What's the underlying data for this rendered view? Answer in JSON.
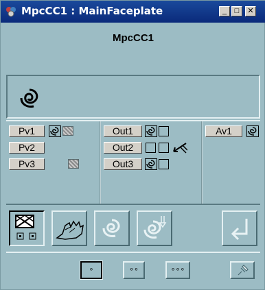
{
  "window": {
    "title": "MpcCC1 : MainFaceplate",
    "min_label": "_",
    "max_label": "□",
    "close_label": "✕"
  },
  "header": {
    "name": "MpcCC1"
  },
  "status_panel": {
    "icon": "mpc-swirl-icon"
  },
  "inputs": [
    {
      "label": "Pv1"
    },
    {
      "label": "Pv2"
    },
    {
      "label": "Pv3"
    }
  ],
  "outputs": [
    {
      "label": "Out1"
    },
    {
      "label": "Out2"
    },
    {
      "label": "Out3"
    }
  ],
  "auxiliary": [
    {
      "label": "Av1"
    }
  ],
  "mode_buttons": [
    {
      "name": "disabled-mode",
      "icon": "crossed-envelope-icon"
    },
    {
      "name": "manual-mode",
      "icon": "hand-icon"
    },
    {
      "name": "auto-mode",
      "icon": "swirl-icon"
    },
    {
      "name": "cascade-mode",
      "icon": "swirl-plug-icon"
    },
    {
      "name": "enter",
      "icon": "enter-arrow-icon"
    }
  ],
  "view_buttons": [
    {
      "label": "∘"
    },
    {
      "label": "∘∘"
    },
    {
      "label": "∘∘∘"
    }
  ],
  "colors": {
    "background": "#9cbcc4",
    "titlebar": "#0a2a7a"
  }
}
